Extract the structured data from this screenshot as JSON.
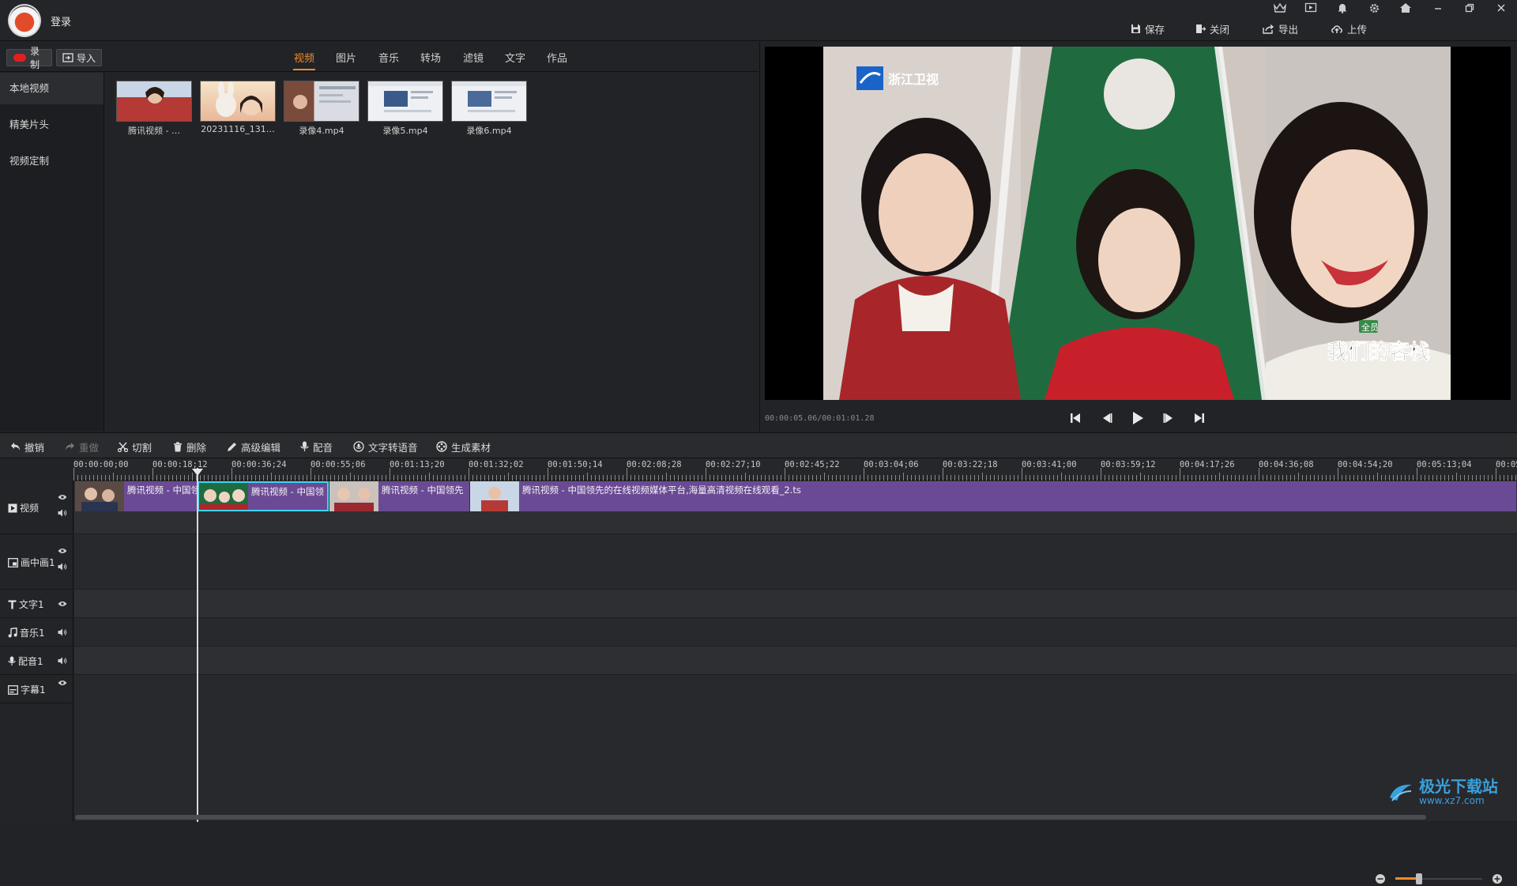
{
  "titlebar": {
    "login_label": "登录",
    "icons": [
      "crown-icon",
      "screen-icon",
      "bell-icon",
      "gear-icon",
      "home-icon",
      "minimize-icon",
      "restore-icon",
      "close-icon"
    ],
    "actions": [
      {
        "label": "保存",
        "icon": "save-icon"
      },
      {
        "label": "关闭",
        "icon": "exit-icon"
      },
      {
        "label": "导出",
        "icon": "export-icon"
      },
      {
        "label": "上传",
        "icon": "upload-icon"
      }
    ]
  },
  "library": {
    "record_label": "录制",
    "import_label": "导入",
    "tabs": [
      "视频",
      "图片",
      "音乐",
      "转场",
      "滤镜",
      "文字",
      "作品"
    ],
    "active_tab": "视频",
    "sidebar": [
      "本地视频",
      "精美片头",
      "视频定制"
    ],
    "media": [
      {
        "caption": "腾讯视频 - …"
      },
      {
        "caption": "20231116_131…"
      },
      {
        "caption": "录像4.mp4"
      },
      {
        "caption": "录像5.mp4"
      },
      {
        "caption": "录像6.mp4"
      }
    ]
  },
  "preview": {
    "timecode": "00:00:05.06/00:01:01.28",
    "overlay_logo": "浙江卫视",
    "overlay_show": "我们的客栈",
    "overlay_badge": "全员"
  },
  "edit_toolbar": [
    {
      "label": "撤销",
      "icon": "undo-icon",
      "enabled": true
    },
    {
      "label": "重做",
      "icon": "redo-icon",
      "enabled": false
    },
    {
      "label": "切割",
      "icon": "scissors-icon",
      "enabled": true
    },
    {
      "label": "删除",
      "icon": "trash-icon",
      "enabled": true
    },
    {
      "label": "高级编辑",
      "icon": "pen-icon",
      "enabled": true
    },
    {
      "label": "配音",
      "icon": "mic-icon",
      "enabled": true
    },
    {
      "label": "文字转语音",
      "icon": "speech-icon",
      "enabled": true
    },
    {
      "label": "生成素材",
      "icon": "film-reel-icon",
      "enabled": true
    }
  ],
  "ruler": [
    "00:00:00;00",
    "00:00:18;12",
    "00:00:36;24",
    "00:00:55;06",
    "00:01:13;20",
    "00:01:32;02",
    "00:01:50;14",
    "00:02:08;28",
    "00:02:27;10",
    "00:02:45;22",
    "00:03:04;06",
    "00:03:22;18",
    "00:03:41;00",
    "00:03:59;12",
    "00:04:17;26",
    "00:04:36;08",
    "00:04:54;20",
    "00:05:13;04",
    "00:05"
  ],
  "tracks": [
    {
      "name": "视频",
      "icon": "play-square-icon"
    },
    {
      "name": "画中画1",
      "icon": "pip-icon"
    },
    {
      "name": "文字1",
      "icon": "text-icon"
    },
    {
      "name": "音乐1",
      "icon": "music-icon"
    },
    {
      "name": "配音1",
      "icon": "mic-icon"
    },
    {
      "name": "字幕1",
      "icon": "subtitle-icon"
    }
  ],
  "clips": [
    {
      "label": "腾讯视频 - 中国领"
    },
    {
      "label": "腾讯视频 - 中国领"
    },
    {
      "label": "腾讯视频 - 中国领先"
    },
    {
      "label": "腾讯视频 - 中国领先的在线视频媒体平台,海量高清视频在线观看_2.ts"
    }
  ],
  "zoom_level": 0.27,
  "watermark": {
    "title": "极光下载站",
    "url": "www.xz7.com"
  },
  "colors": {
    "accent": "#f08c2a",
    "clip": "#6b4a95",
    "selection": "#3ed4f0",
    "record": "#e02020"
  }
}
